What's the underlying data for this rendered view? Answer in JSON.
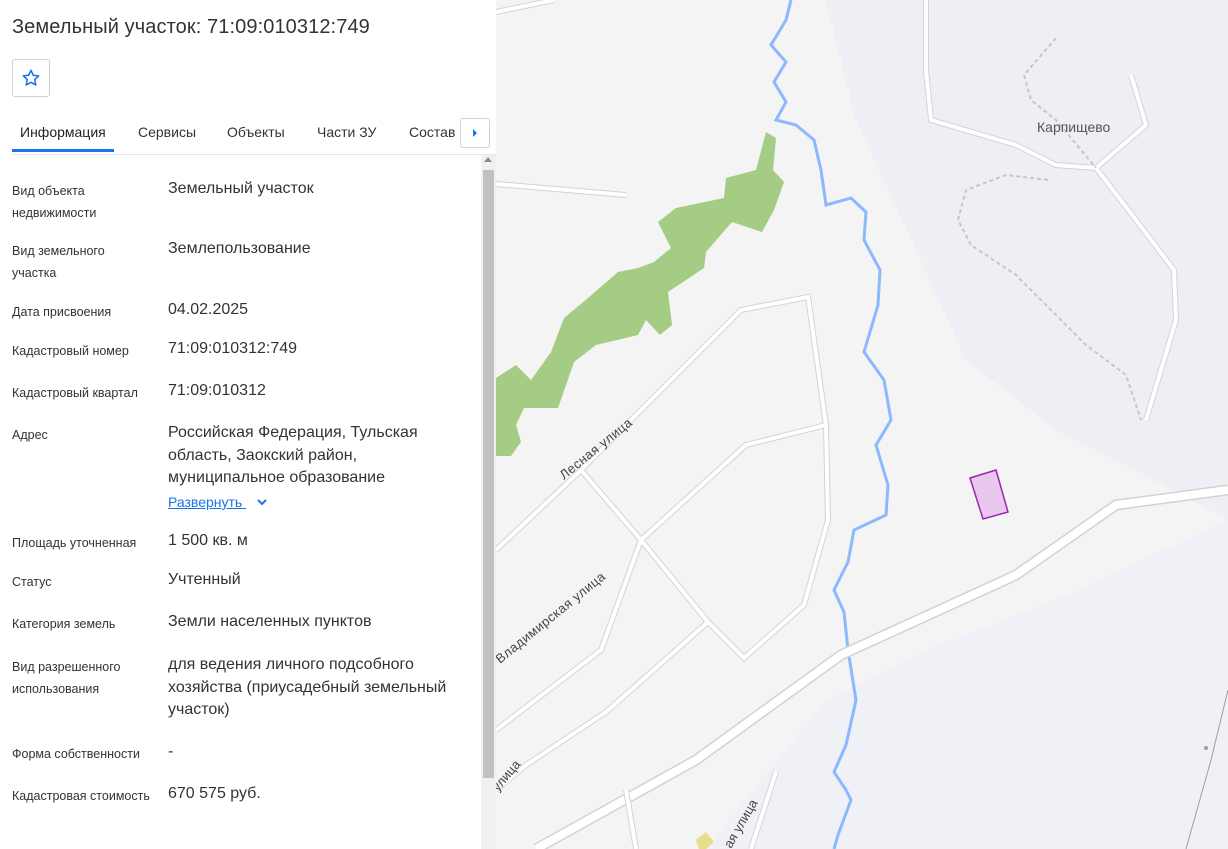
{
  "title": "Земельный участок: 71:09:010312:749",
  "tabs": [
    "Информация",
    "Сервисы",
    "Объекты",
    "Части ЗУ",
    "Состав"
  ],
  "rows": [
    {
      "label": "Вид объекта недвижимости",
      "value": "Земельный участок"
    },
    {
      "label": "Вид земельного участка",
      "value": "Землепользование"
    },
    {
      "label": "Дата присвоения",
      "value": "04.02.2025"
    },
    {
      "label": "Кадастровый номер",
      "value": "71:09:010312:749"
    },
    {
      "label": "Кадастровый квартал",
      "value": "71:09:010312"
    },
    {
      "label": "Адрес",
      "value": "Российская Федерация, Тульская область, Заокский район, муниципальное образование"
    },
    {
      "label": "Площадь уточненная",
      "value": "1 500 кв. м"
    },
    {
      "label": "Статус",
      "value": "Учтенный"
    },
    {
      "label": "Категория земель",
      "value": "Земли населенных пунктов"
    },
    {
      "label": "Вид разрешенного использования",
      "value": "для ведения личного подсобного хозяйства (приусадебный земельный участок)"
    },
    {
      "label": "Форма собственности",
      "value": "-"
    },
    {
      "label": "Кадастровая стоимость",
      "value": "670 575 руб."
    }
  ],
  "expand_label": "Развернуть",
  "map": {
    "place_label": "Карпищево",
    "streets": [
      "Лесная улица",
      "Владимирская улица",
      "улица",
      "ая улица"
    ]
  },
  "colors": {
    "accent": "#1a73e8",
    "parcel_fill": "#e8c8ec",
    "parcel_stroke": "#9c27b0",
    "forest": "#a5cc84",
    "river": "#8cb8ff"
  }
}
